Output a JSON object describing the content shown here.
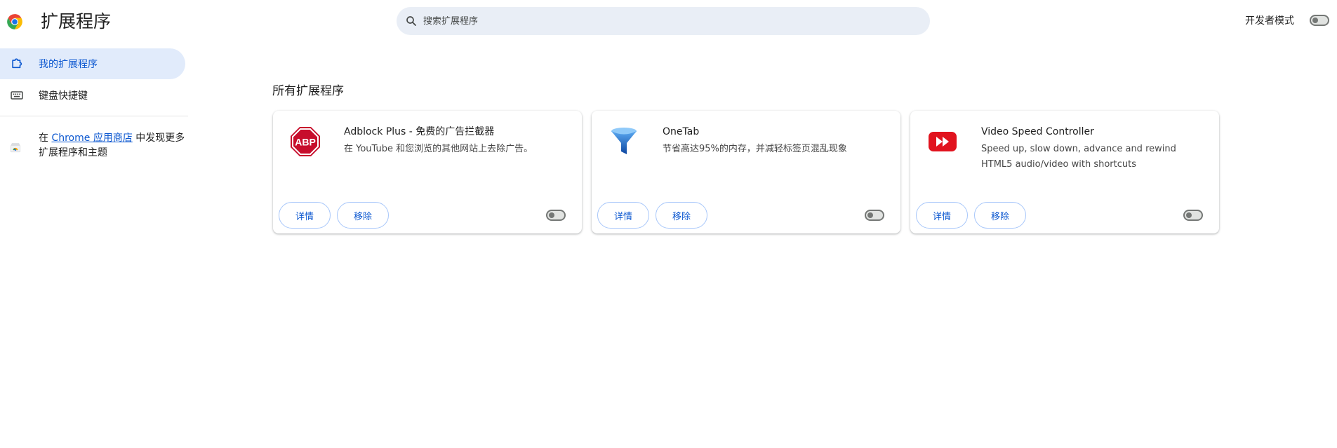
{
  "header": {
    "title": "扩展程序",
    "search_placeholder": "搜索扩展程序",
    "dev_mode_label": "开发者模式",
    "dev_mode_on": false
  },
  "sidebar": {
    "items": [
      {
        "label": "我的扩展程序",
        "icon": "puzzle-piece-icon",
        "selected": true
      },
      {
        "label": "键盘快捷键",
        "icon": "keyboard-icon",
        "selected": false
      }
    ],
    "store": {
      "prefix": "在 ",
      "link": "Chrome 应用商店",
      "suffix": " 中发现更多扩展程序和主题"
    }
  },
  "main": {
    "section_title": "所有扩展程序",
    "extensions": [
      {
        "name": "Adblock Plus - 免费的广告拦截器",
        "description": "在 YouTube 和您浏览的其他网站上去除广告。",
        "icon": "adblock-plus-icon",
        "icon_text": "ABP",
        "details_label": "详情",
        "remove_label": "移除",
        "enabled": false
      },
      {
        "name": "OneTab",
        "description": "节省高达95%的内存，并减轻标签页混乱现象",
        "icon": "onetab-funnel-icon",
        "details_label": "详情",
        "remove_label": "移除",
        "enabled": false
      },
      {
        "name": "Video Speed Controller",
        "description": "Speed up, slow down, advance and rewind HTML5 audio/video with shortcuts",
        "icon": "video-speed-controller-icon",
        "details_label": "详情",
        "remove_label": "移除",
        "enabled": false
      }
    ]
  },
  "colors": {
    "accent": "#0b57d0",
    "selected_bg": "#e1ebfb",
    "search_bg": "#e9eef6",
    "button_border": "#a8c7fa"
  }
}
